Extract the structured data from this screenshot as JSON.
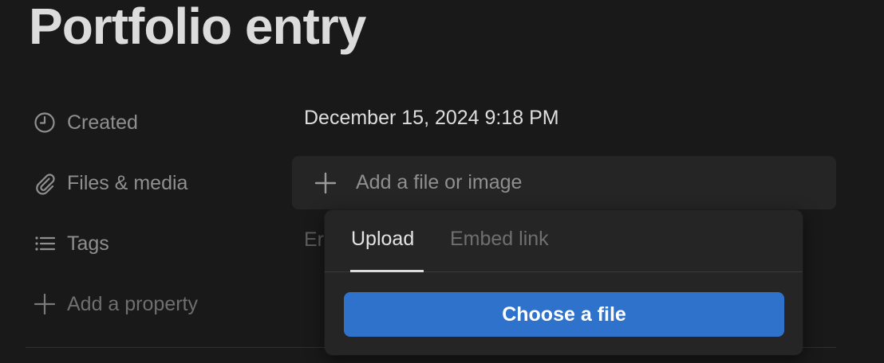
{
  "page": {
    "title": "Portfolio entry"
  },
  "properties": {
    "created": {
      "icon": "clock-icon",
      "label": "Created",
      "value": "December 15, 2024 9:18 PM"
    },
    "files": {
      "icon": "paperclip-icon",
      "label": "Files & media",
      "placeholder": "Add a file or image"
    },
    "tags": {
      "icon": "list-icon",
      "label": "Tags",
      "value_partial": "Er"
    },
    "add_property": {
      "icon": "plus-icon",
      "label": "Add a property"
    }
  },
  "popover": {
    "tabs": [
      {
        "label": "Upload",
        "active": true
      },
      {
        "label": "Embed link",
        "active": false
      }
    ],
    "choose_button": "Choose a file",
    "button_color": "#2f72cc"
  },
  "colors": {
    "background": "#191919",
    "panel": "#252525",
    "accent": "#2f72cc"
  }
}
